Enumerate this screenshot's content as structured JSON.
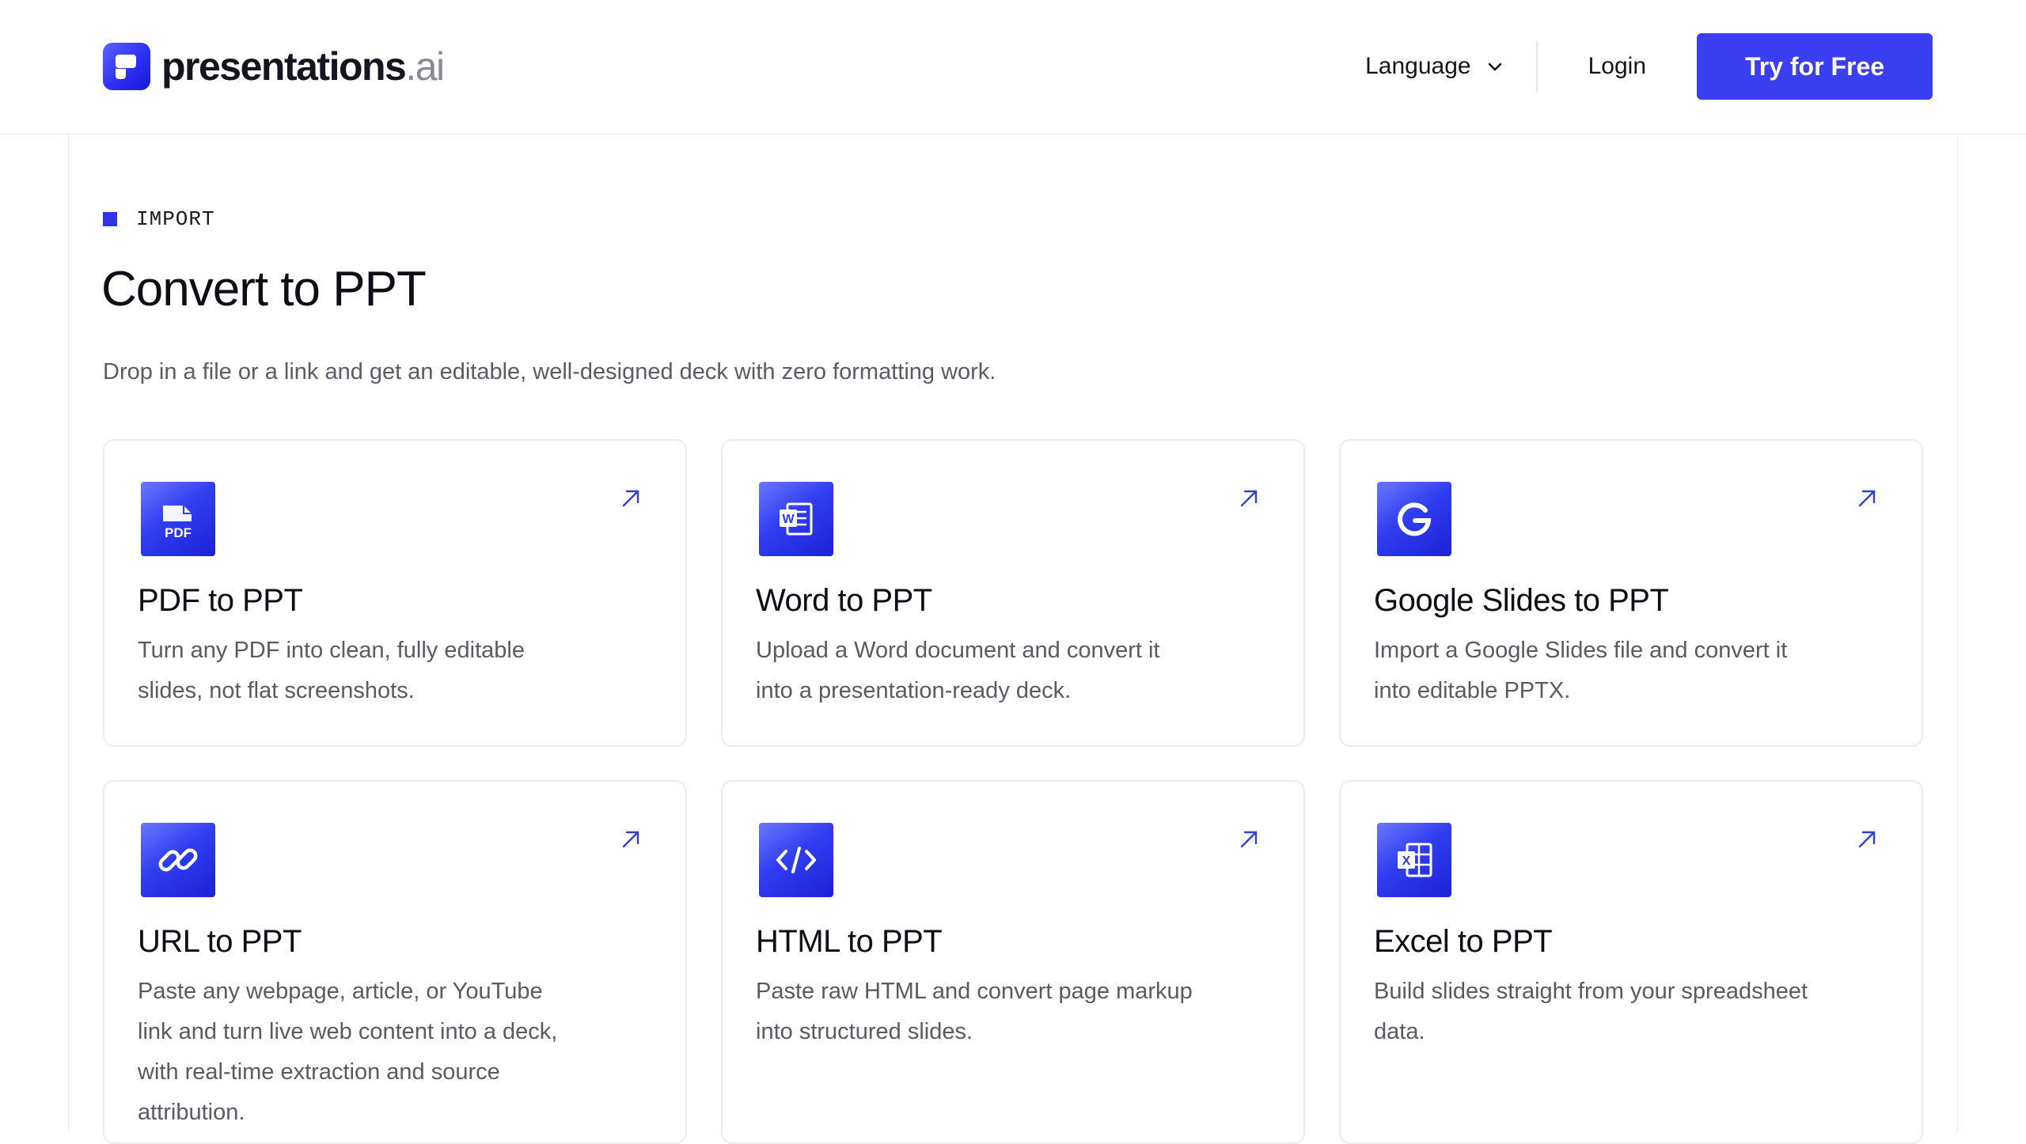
{
  "header": {
    "logo_main": "presentations",
    "logo_ext": ".ai",
    "language_label": "Language",
    "login_label": "Login",
    "cta_label": "Try for Free"
  },
  "hero": {
    "eyebrow": "IMPORT",
    "title": "Convert to PPT",
    "subtitle": "Drop in a file or a link and get an editable, well-designed deck with zero formatting work."
  },
  "cards": [
    {
      "icon": "pdf-icon",
      "title": "PDF to PPT",
      "desc": "Turn any PDF into clean, fully editable slides, not flat screenshots."
    },
    {
      "icon": "word-icon",
      "title": "Word to PPT",
      "desc": "Upload a Word document and convert it into a presentation-ready deck."
    },
    {
      "icon": "google-icon",
      "title": "Google Slides to PPT",
      "desc": "Import a Google Slides file and convert it into editable PPTX."
    },
    {
      "icon": "link-icon",
      "title": "URL to PPT",
      "desc": "Paste any webpage, article, or YouTube link and turn live web content into a deck, with real-time extraction and source attribution."
    },
    {
      "icon": "code-icon",
      "title": "HTML to PPT",
      "desc": "Paste raw HTML and convert page markup into structured slides."
    },
    {
      "icon": "excel-icon",
      "title": "Excel to PPT",
      "desc": "Build slides straight from your spreadsheet data."
    }
  ],
  "colors": {
    "accent": "#3b3ff2",
    "text": "#0e0e16",
    "muted": "#5a5a64",
    "border": "#ededf1"
  }
}
